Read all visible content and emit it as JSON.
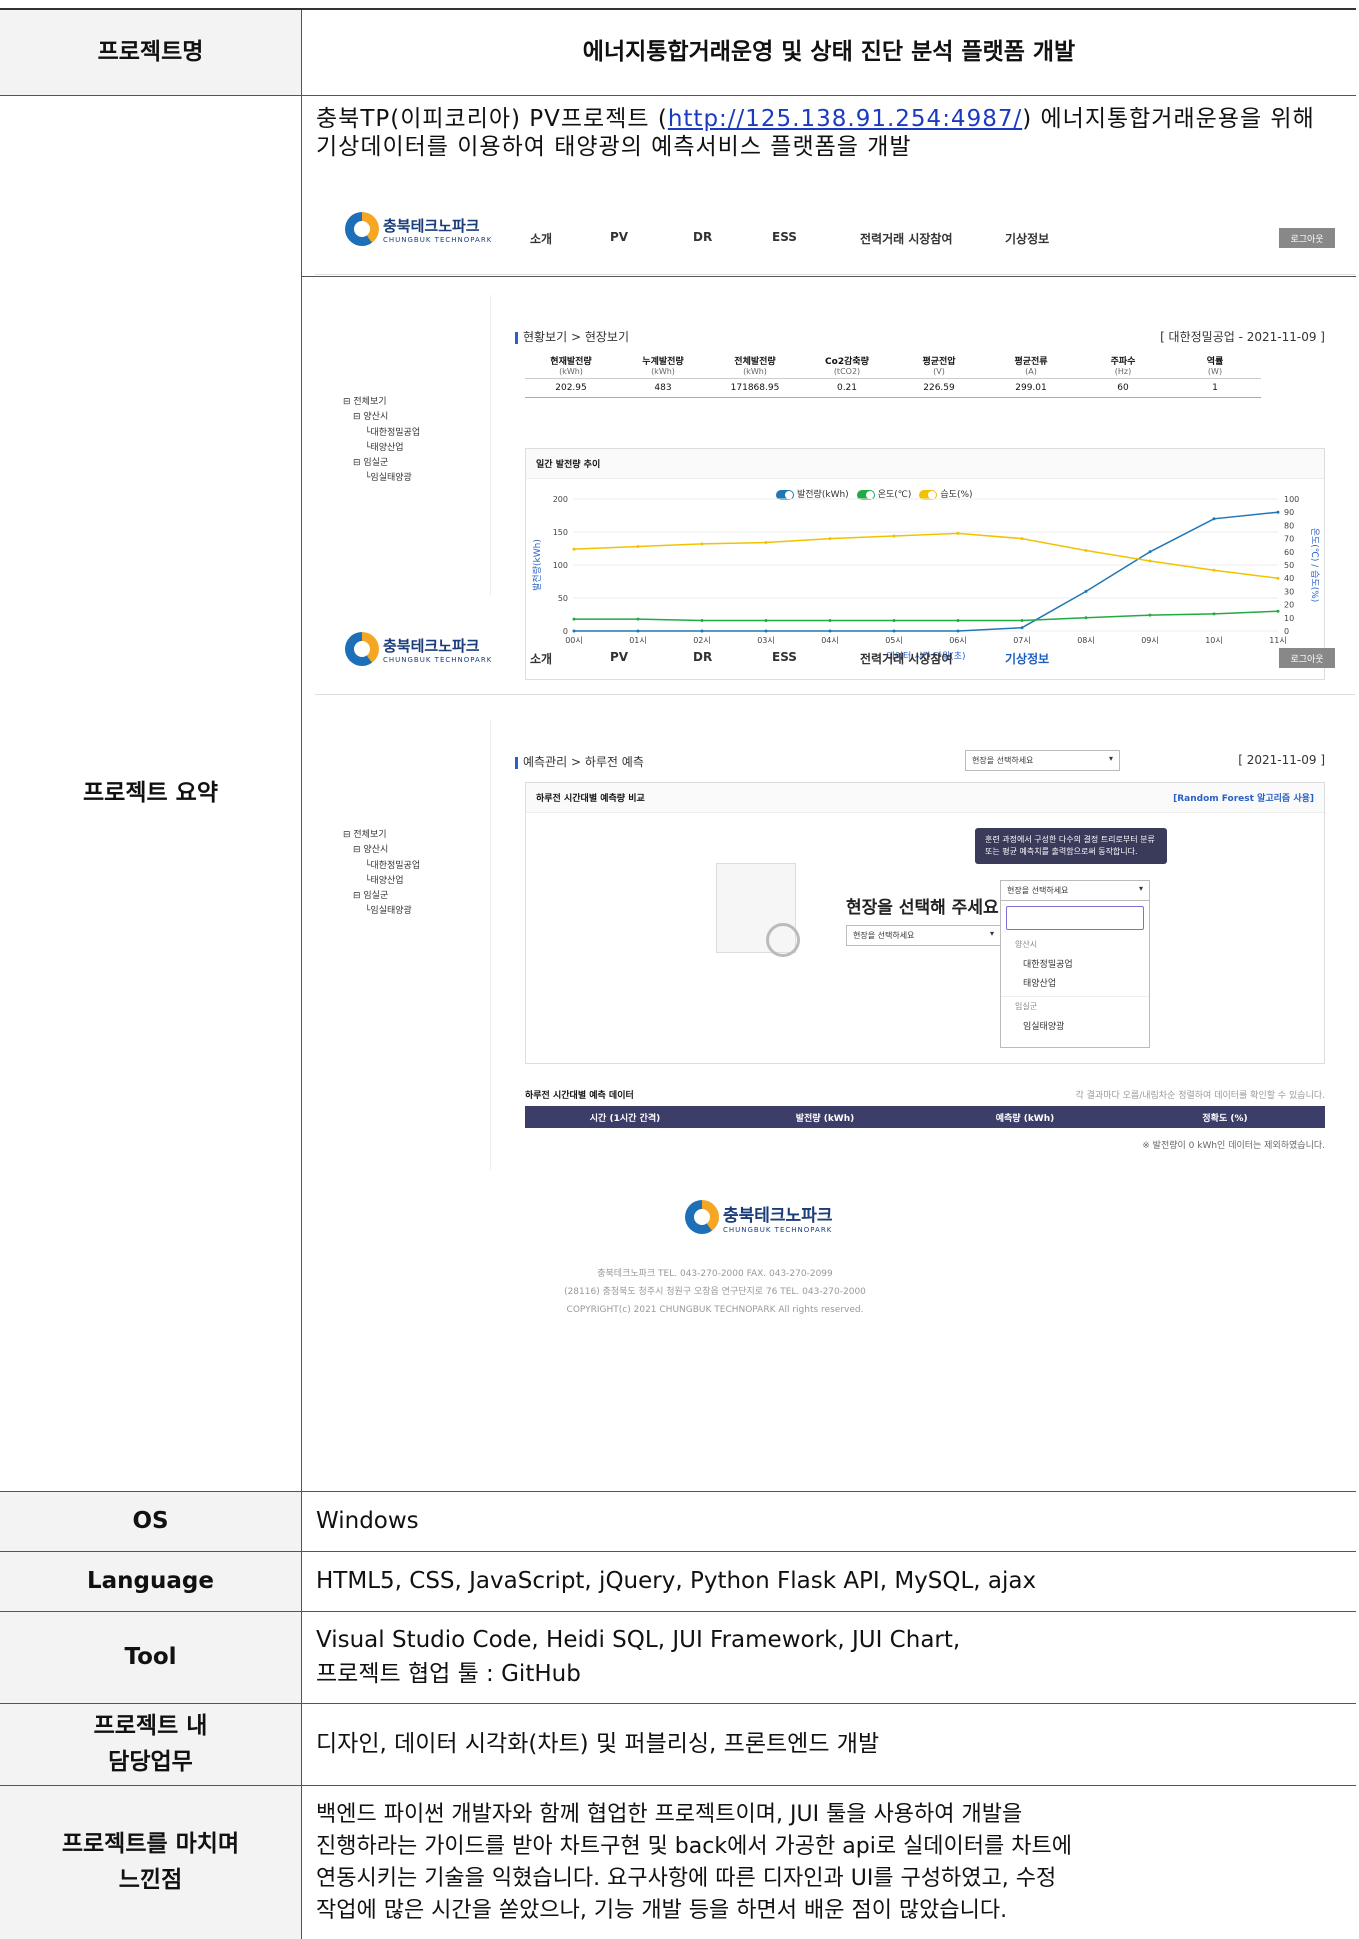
{
  "table": {
    "project_name_label": "프로젝트명",
    "project_name": "에너지통합거래운영 및 상태 진단 분석 플랫폼 개발",
    "summary_label": "프로젝트 요약",
    "summary_text_before": "충북TP(이피코리아) PV프로젝트 (",
    "summary_link": "http://125.138.91.254:4987/",
    "summary_text_after": ") 에너지통합거래운용을 위해 기상데이터를 이용하여 태양광의 예측서비스 플랫폼을 개발",
    "os_label": "OS",
    "os": "Windows",
    "language_label": "Language",
    "language": "HTML5, CSS, JavaScript, jQuery, Python Flask API, MySQL, ajax",
    "tool_label": "Tool",
    "tool_line1": "Visual Studio Code, Heidi SQL, JUI Framework, JUI Chart,",
    "tool_line2": "프로젝트 협업 툴 : GitHub",
    "duty_label_1": "프로젝트 내",
    "duty_label_2": "담당업무",
    "duty": "디자인, 데이터 시각화(차트) 및 퍼블리싱, 프론트엔드 개발",
    "feel_label_1": "프로젝트를 마치며",
    "feel_label_2": "느낀점",
    "feel_1": "백엔드 파이썬 개발자와 함께 협업한 프로젝트이며, JUI 툴을 사용하여 개발을",
    "feel_2": "진행하라는 가이드를 받아 차트구현 및 back에서 가공한 api로 실데이터를 차트에",
    "feel_3": "연동시키는 기술을 익혔습니다. 요구사항에 따른 디자인과 UI를 구성하였고, 수정",
    "feel_4": "작업에 많은 시간을 쏟았으나, 기능 개발 등을 하면서 배운 점이 많았습니다."
  },
  "shot": {
    "logo_text": "충북테크노파크",
    "logo_sub": "CHUNGBUK TECHNOPARK",
    "menu": [
      "소개",
      "PV",
      "DR",
      "ESS",
      "전력거래 시장참여",
      "기상정보"
    ],
    "logout": "로그아웃",
    "crumb1": "현황보기 > 현장보기",
    "stamp1": "[ 대한정밀공업 - 2021-11-09 ]",
    "stats_headers": [
      "현재발전량",
      "누계발전량",
      "전체발전량",
      "Co2감축량",
      "평균전압",
      "평균전류",
      "주파수",
      "역률"
    ],
    "stats_units": [
      "(kWh)",
      "(kWh)",
      "(kWh)",
      "(tCO2)",
      "(V)",
      "(A)",
      "(Hz)",
      "(W)"
    ],
    "stats_values": [
      "202.95",
      "483",
      "171868.95",
      "0.21",
      "226.59",
      "299.01",
      "60",
      "1"
    ],
    "tree": [
      "전체보기",
      "양산시",
      "대한정밀공업",
      "태양산업",
      "임실군",
      "임실태양광"
    ],
    "panel1_title": "일간 발전량 추이",
    "legend": [
      "발전량(kWh)",
      "온도(℃)",
      "습도(%)"
    ],
    "crumb2": "예측관리 > 하루전 예측",
    "select_placeholder": "현장을 선택하세요",
    "stamp2": "[ 2021-11-09 ]",
    "panel2_title": "하루전 시간대별 예측량 비교",
    "rf_label": "[Random Forest 알고리즘 사용]",
    "tooltip_1": "훈련 과정에서 구성한 다수의 결정 트리로부터 분류",
    "tooltip_2": "또는 평균 예측치를 출력함으로써 동작합니다.",
    "empty_msg": "현장을 선택해 주세요",
    "dd_groups": [
      "양산시",
      "임실군"
    ],
    "dd_items_1": [
      "대한정밀공업",
      "태양산업"
    ],
    "dd_items_2": [
      "임실태양광"
    ],
    "panel3_title": "하루전 시간대별 예측 데이터",
    "panel3_note": "각 결과마다 오름/내림차순 정렬하여 데이터를 확인할 수 있습니다.",
    "bar_cols": [
      "시간 (1시간 간격)",
      "발전량 (kWh)",
      "예측량 (kWh)",
      "정확도 (%)"
    ],
    "bar_note": "※ 발전량이 0 kWh인 데이터는 제외하였습니다.",
    "footer_1": "충북테크노파크      TEL. 043-270-2000      FAX. 043-270-2099",
    "footer_2": "(28116) 충청북도 청주시 청원구 오창읍 연구단지로 76 TEL. 043-270-2000",
    "footer_3": "COPYRIGHT(c) 2021 CHUNGBUK TECHNOPARK All rights reserved."
  },
  "chart_data": {
    "type": "line",
    "title": "일간 발전량 추이",
    "xlabel": "데이터 시간 단위(초)",
    "ylabel": "발전량(kWh)",
    "y2label": "온도(℃) / 습도(%)",
    "categories": [
      "00시",
      "01시",
      "02시",
      "03시",
      "04시",
      "05시",
      "06시",
      "07시",
      "08시",
      "09시",
      "10시",
      "11시"
    ],
    "ylim": [
      0,
      200
    ],
    "y_ticks": [
      0,
      50,
      100,
      150,
      200
    ],
    "y2lim": [
      0,
      100
    ],
    "y2_ticks": [
      0,
      10,
      20,
      30,
      40,
      50,
      60,
      70,
      80,
      90,
      100
    ],
    "series": [
      {
        "name": "발전량(kWh)",
        "color": "#1f77b4",
        "axis": "left",
        "values": [
          0,
          0,
          0,
          0,
          0,
          0,
          0,
          5,
          60,
          120,
          170,
          180
        ]
      },
      {
        "name": "온도(℃)",
        "color": "#22aa44",
        "axis": "right",
        "values": [
          9,
          9,
          8,
          8,
          8,
          8,
          8,
          8,
          10,
          12,
          13,
          15
        ]
      },
      {
        "name": "습도(%)",
        "color": "#f2c200",
        "axis": "right",
        "values": [
          62,
          64,
          66,
          67,
          70,
          72,
          74,
          70,
          61,
          53,
          46,
          40
        ]
      }
    ],
    "colors": {
      "power": "#1f77b4",
      "temp": "#22aa44",
      "humidity": "#f2c200"
    }
  }
}
